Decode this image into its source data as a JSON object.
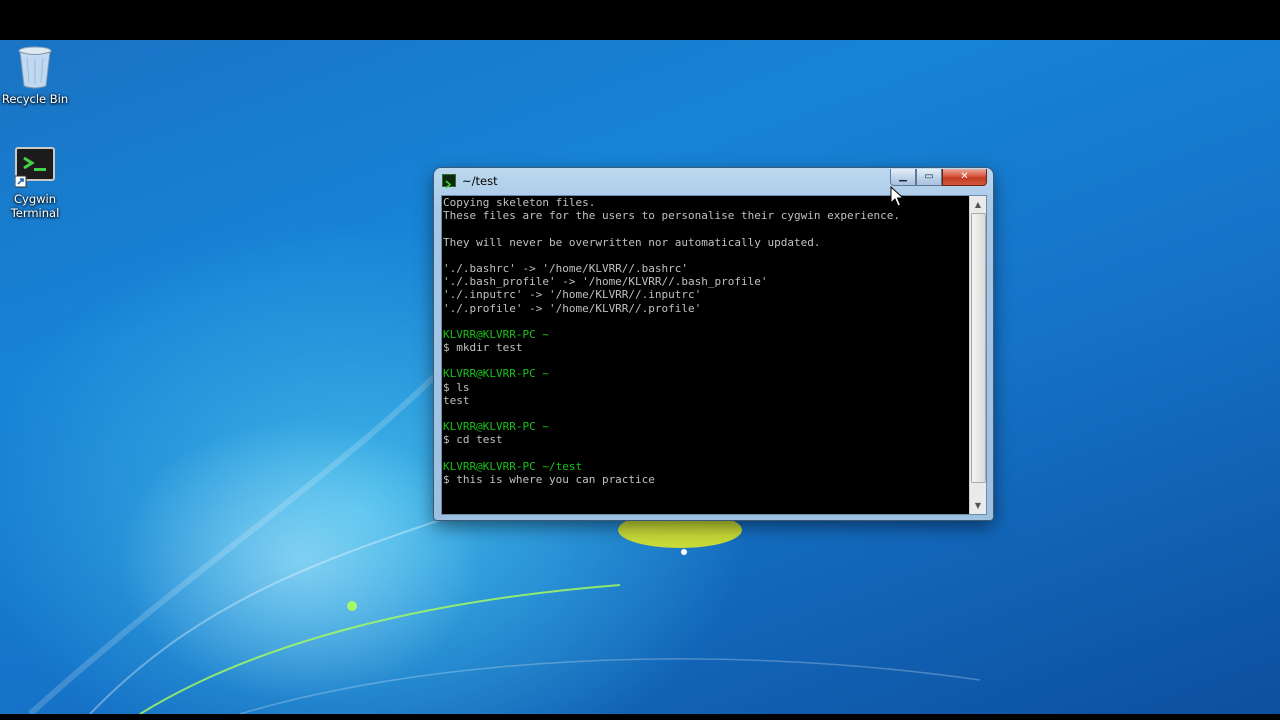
{
  "desktop": {
    "icons": [
      {
        "label": "Recycle Bin",
        "icon": "recycle-bin-icon"
      },
      {
        "label": "Cygwin\nTerminal",
        "icon": "cygwin-terminal-icon"
      }
    ]
  },
  "window": {
    "title": "~/test",
    "icon": "cygwin-icon",
    "controls": {
      "minimize": "minimize-icon",
      "maximize": "maximize-icon",
      "close": "close-icon"
    },
    "minimize_glyph": "▁",
    "maximize_glyph": "▭",
    "close_glyph": "✕"
  },
  "terminal": {
    "colors": {
      "background": "#000000",
      "text": "#c0c0c0",
      "prompt": "#19c119"
    },
    "lines": [
      {
        "text": "Copying skeleton files.",
        "color": "default"
      },
      {
        "text": "These files are for the users to personalise their cygwin experience.",
        "color": "default"
      },
      {
        "text": "",
        "color": "default"
      },
      {
        "text": "They will never be overwritten nor automatically updated.",
        "color": "default"
      },
      {
        "text": "",
        "color": "default"
      },
      {
        "text": "'./.bashrc' -> '/home/KLVRR//.bashrc'",
        "color": "default"
      },
      {
        "text": "'./.bash_profile' -> '/home/KLVRR//.bash_profile'",
        "color": "default"
      },
      {
        "text": "'./.inputrc' -> '/home/KLVRR//.inputrc'",
        "color": "default"
      },
      {
        "text": "'./.profile' -> '/home/KLVRR//.profile'",
        "color": "default"
      },
      {
        "text": "",
        "color": "default"
      },
      {
        "text": "KLVRR@KLVRR-PC ~",
        "color": "green"
      },
      {
        "text": "$ mkdir test",
        "color": "default"
      },
      {
        "text": "",
        "color": "default"
      },
      {
        "text": "KLVRR@KLVRR-PC ~",
        "color": "green"
      },
      {
        "text": "$ ls",
        "color": "default"
      },
      {
        "text": "test",
        "color": "default"
      },
      {
        "text": "",
        "color": "default"
      },
      {
        "text": "KLVRR@KLVRR-PC ~",
        "color": "green"
      },
      {
        "text": "$ cd test",
        "color": "default"
      },
      {
        "text": "",
        "color": "default"
      },
      {
        "text": "KLVRR@KLVRR-PC ~/test",
        "color": "green"
      },
      {
        "text": "$ this is where you can practice",
        "color": "default"
      }
    ],
    "scroll_up_glyph": "▲",
    "scroll_down_glyph": "▼"
  }
}
